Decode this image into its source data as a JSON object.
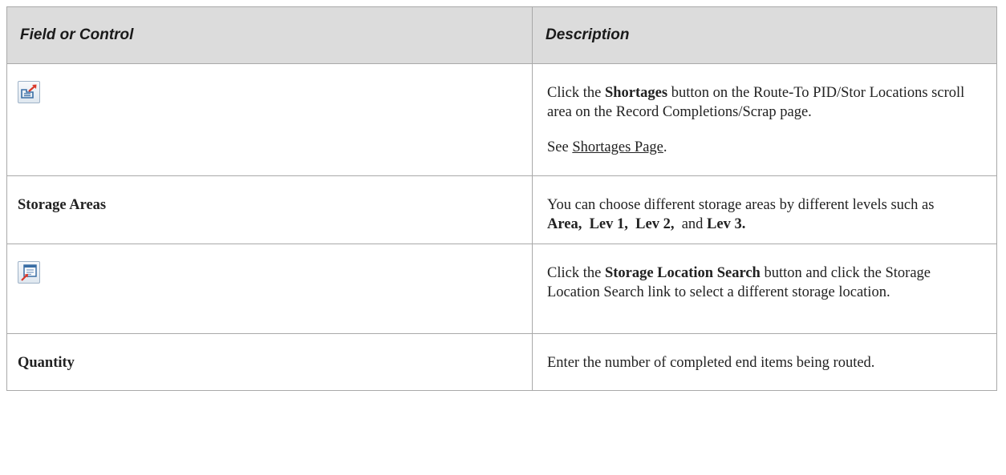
{
  "table": {
    "header": {
      "col1": "Field or Control",
      "col2": "Description"
    },
    "rows": [
      {
        "field_icon": "shortages-icon",
        "desc_parts": [
          "Click the ",
          "Shortages",
          " button on the Route-To PID/Stor Locations scroll area on the Record Completions/Scrap page."
        ],
        "see_prefix": "See ",
        "see_link": "Shortages Page",
        "see_suffix": "."
      },
      {
        "field_label": "Storage Areas",
        "desc_parts": [
          "You can choose different storage areas by different levels such as ",
          "Area,",
          "Lev 1,",
          "Lev 2,",
          "and",
          "Lev 3."
        ]
      },
      {
        "field_icon": "storage-location-search-icon",
        "desc_parts": [
          "Click the ",
          "Storage Location Search",
          " button and click the Storage Location Search link to select a different storage location."
        ]
      },
      {
        "field_label": "Quantity",
        "desc": "Enter the number of completed end items being routed."
      }
    ]
  },
  "colors": {
    "header_bg": "#dcdcdc",
    "border": "#a9a9a9",
    "icon_arrow": "#d9382a",
    "icon_body": "#3a6ea5"
  }
}
